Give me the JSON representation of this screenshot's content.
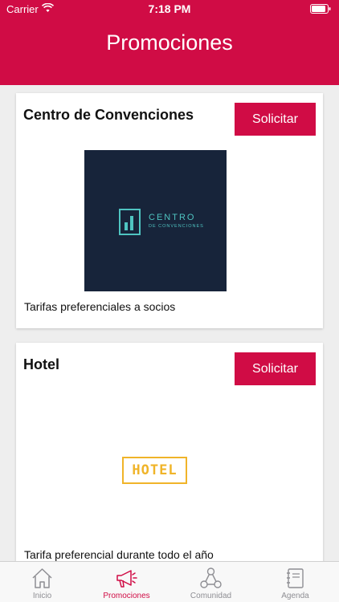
{
  "status_bar": {
    "carrier": "Carrier",
    "time": "7:18 PM",
    "wifi_icon": "wifi-icon",
    "battery_icon": "battery-icon"
  },
  "header": {
    "title": "Promociones"
  },
  "cards": [
    {
      "title": "Centro de Convenciones",
      "button": "Solicitar",
      "logo": {
        "word1": "CENTRO",
        "word2": "DE CONVENCIONES"
      },
      "description": "Tarifas preferenciales a socios"
    },
    {
      "title": "Hotel",
      "button": "Solicitar",
      "logo": {
        "text": "HOTEL"
      },
      "description": "Tarifa preferencial durante todo el año"
    }
  ],
  "tabbar": {
    "tabs": [
      {
        "label": "Inicio",
        "icon": "home-icon",
        "active": false
      },
      {
        "label": "Promociones",
        "icon": "megaphone-icon",
        "active": true
      },
      {
        "label": "Comunidad",
        "icon": "community-icon",
        "active": false
      },
      {
        "label": "Agenda",
        "icon": "agenda-icon",
        "active": false
      }
    ]
  },
  "colors": {
    "accent": "#d00c45",
    "logo_navy": "#17243a",
    "logo_teal": "#4fc4c1",
    "hotel_gold": "#f0b429"
  }
}
